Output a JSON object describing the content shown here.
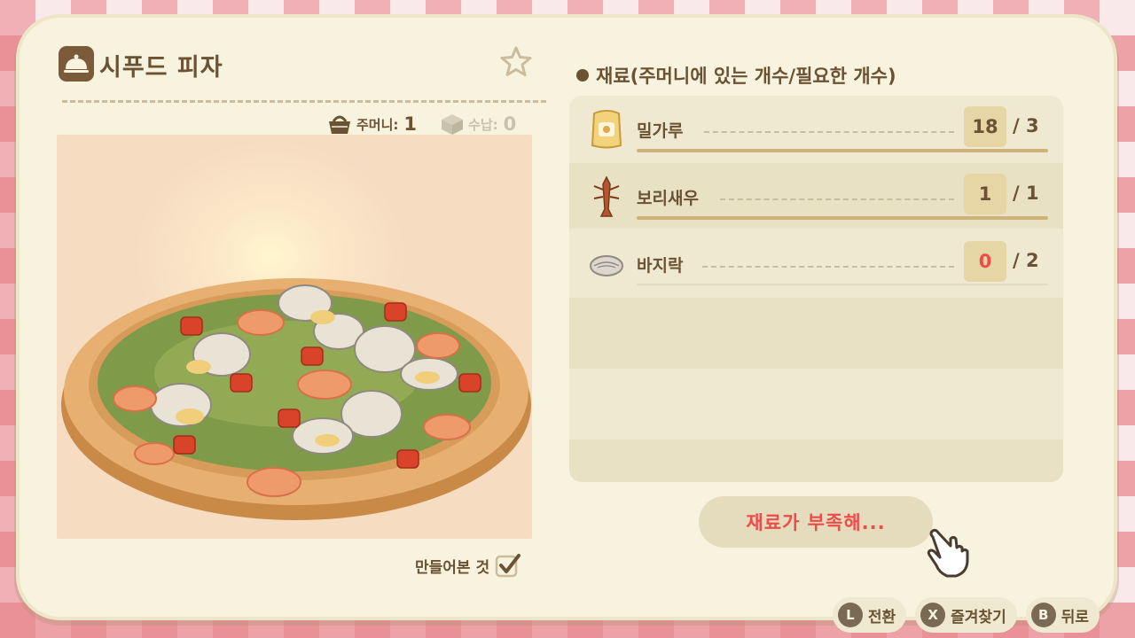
{
  "recipe": {
    "title": "시푸드 피자",
    "icon": "serving-bell-icon"
  },
  "counts": {
    "pocket_label": "주머니:",
    "pocket_value": "1",
    "storage_label": "수납:",
    "storage_value": "0"
  },
  "made_label": "만들어본 것",
  "ingredients_header": "재료(주머니에 있는 개수/필요한 개수)",
  "ingredients": [
    {
      "name": "밀가루",
      "have": "18",
      "need": "/ 3",
      "icon": "flour-sack-icon",
      "enough": true
    },
    {
      "name": "보리새우",
      "have": "1",
      "need": "/ 1",
      "icon": "shrimp-icon",
      "enough": true
    },
    {
      "name": "바지락",
      "have": "0",
      "need": "/ 2",
      "icon": "clam-icon",
      "enough": false
    }
  ],
  "craft_button": "재료가 부족해...",
  "footer": [
    {
      "button": "L",
      "label": "전환"
    },
    {
      "button": "X",
      "label": "즐겨찾기"
    },
    {
      "button": "B",
      "label": "뒤로"
    }
  ],
  "colors": {
    "text_brown": "#6a5233",
    "warning_red": "#f04b4b",
    "panel": "#f7f3df"
  }
}
